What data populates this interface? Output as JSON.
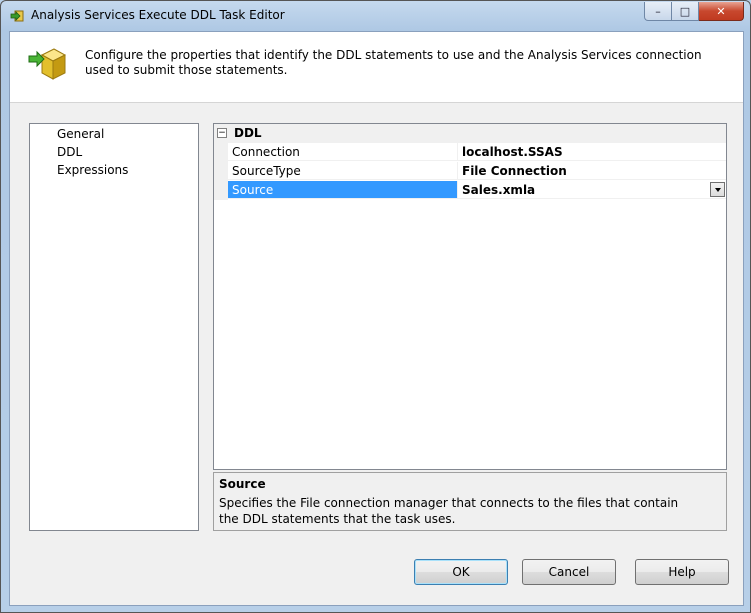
{
  "window": {
    "title": "Analysis Services Execute DDL Task Editor",
    "controls": {
      "minimize": "–",
      "maximize": "□",
      "close": "✕"
    }
  },
  "header": {
    "description": "Configure the properties that identify the DDL statements to use and the Analysis Services connection used to submit those statements."
  },
  "nav": {
    "items": [
      {
        "label": "General"
      },
      {
        "label": "DDL"
      },
      {
        "label": "Expressions"
      }
    ],
    "selected": "DDL"
  },
  "property_grid": {
    "category": {
      "label": "DDL",
      "toggle": "−"
    },
    "rows": [
      {
        "name": "Connection",
        "value": "localhost.SSAS"
      },
      {
        "name": "SourceType",
        "value": "File Connection"
      },
      {
        "name": "Source",
        "value": "Sales.xmla"
      }
    ],
    "selected_row": "Source"
  },
  "description": {
    "title": "Source",
    "text": "Specifies the File connection manager that connects to the files that contain the DDL statements that the task uses."
  },
  "buttons": {
    "ok": "OK",
    "cancel": "Cancel",
    "help": "Help"
  },
  "colors": {
    "selection": "#3399ff",
    "window_frame": "#b9d1ea"
  }
}
